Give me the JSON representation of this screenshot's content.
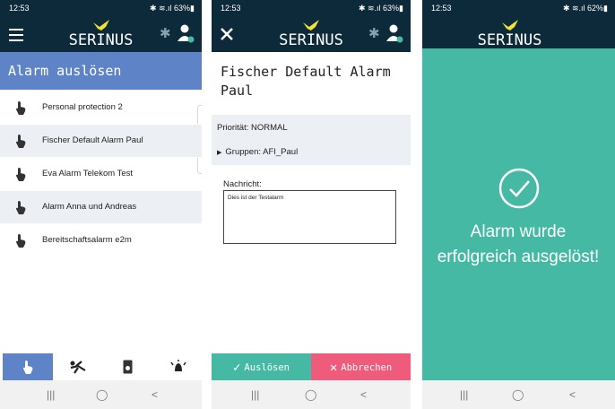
{
  "screens": [
    {
      "status_time": "12:53",
      "status_right": "✱ ≋.ıl 63%▮",
      "app_name": "SERINUS",
      "title": "Alarm auslösen",
      "alarms": [
        {
          "label": "Personal protection 2"
        },
        {
          "label": "Fischer Default Alarm Paul"
        },
        {
          "label": "Eva Alarm Telekom Test"
        },
        {
          "label": "Alarm Anna und Andreas"
        },
        {
          "label": "Bereitschaftsalarm e2m"
        }
      ],
      "bottom_nav": [
        "hand-tap-icon",
        "running-person-icon",
        "device-icon",
        "alarm-bell-icon"
      ],
      "active_nav": 0
    },
    {
      "status_time": "12:53",
      "status_right": "✱ ≋.ıl 63%▮",
      "app_name": "SERINUS",
      "alarm_title": "Fischer Default Alarm Paul",
      "priority": "Priorität: NORMAL",
      "groups": "Gruppen: AFI_Paul",
      "message_label": "Nachricht:",
      "message_text": "Dies ist der Testalarm",
      "confirm_label": "Auslösen",
      "cancel_label": "Abbrechen"
    },
    {
      "status_time": "12:53",
      "status_right": "✱ ≋.ıl 62%▮",
      "app_name": "SERINUS",
      "success_line1": "Alarm wurde",
      "success_line2": "erfolgreich ausgelöst!"
    }
  ],
  "colors": {
    "appbar": "#0d2a3a",
    "title_band": "#5e83c6",
    "success_green": "#45b9a4",
    "cancel_red": "#ef5b7a",
    "row_alt": "#eceff3",
    "logo_yellow": "#f2e335"
  }
}
